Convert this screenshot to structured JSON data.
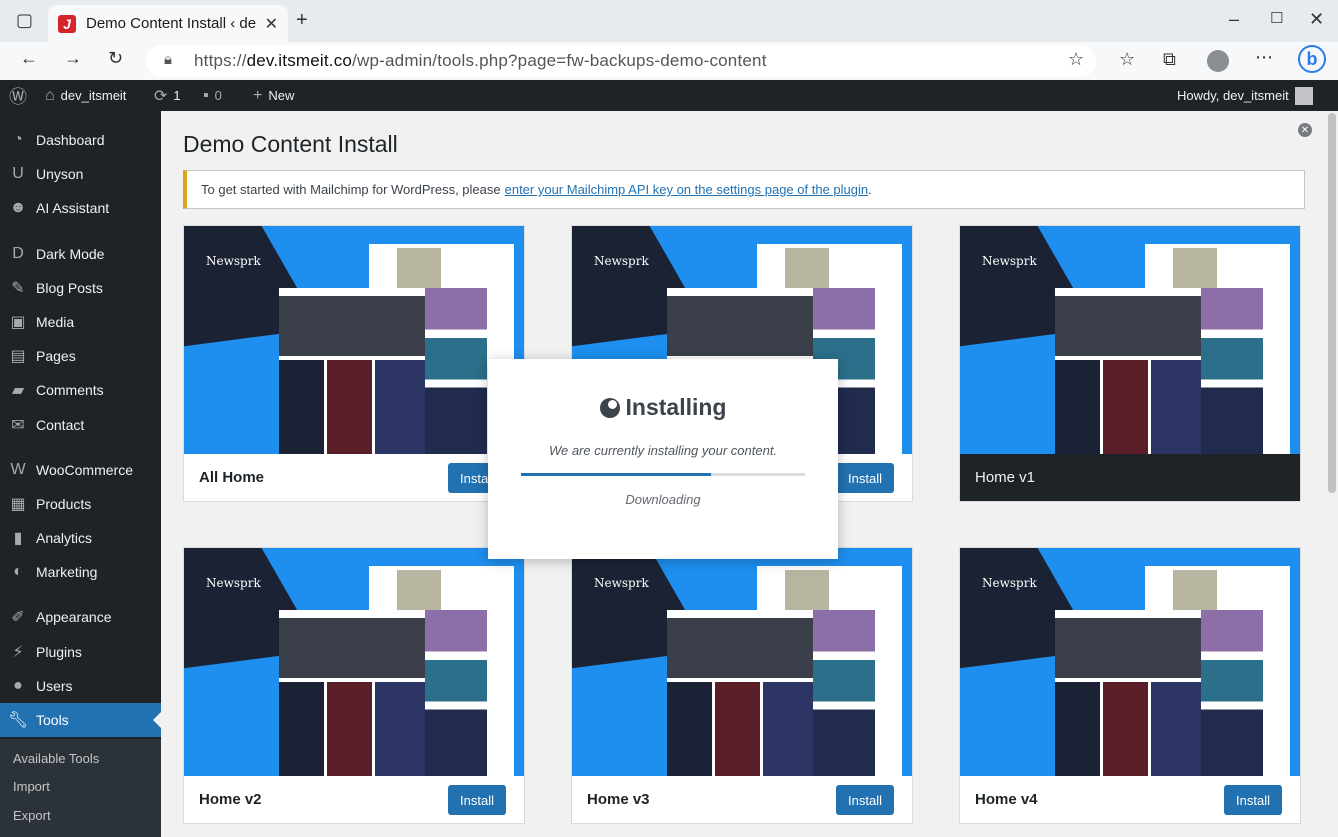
{
  "browser": {
    "tab_title": "Demo Content Install ‹ de",
    "favicon": "J",
    "url_prefix": "https://",
    "url_host": "dev.itsmeit.co",
    "url_path": "/wp-admin/tools.php?page=fw-backups-demo-content"
  },
  "adminbar": {
    "site_name": "dev_itsmeit",
    "updates_count": "1",
    "comments_count": "0",
    "new_label": "New",
    "howdy": "Howdy, dev_itsmeit"
  },
  "sidebar": {
    "items": [
      {
        "label": "Dashboard",
        "icon": "dashboard-icon"
      },
      {
        "label": "Unyson",
        "icon": "unyson-icon"
      },
      {
        "label": "AI Assistant",
        "icon": "ai-icon"
      },
      {
        "label": "Dark Mode",
        "icon": "darkmode-icon"
      },
      {
        "label": "Blog Posts",
        "icon": "pin-icon"
      },
      {
        "label": "Media",
        "icon": "media-icon"
      },
      {
        "label": "Pages",
        "icon": "pages-icon"
      },
      {
        "label": "Comments",
        "icon": "comments-icon"
      },
      {
        "label": "Contact",
        "icon": "mail-icon"
      },
      {
        "label": "WooCommerce",
        "icon": "woo-icon"
      },
      {
        "label": "Products",
        "icon": "products-icon"
      },
      {
        "label": "Analytics",
        "icon": "analytics-icon"
      },
      {
        "label": "Marketing",
        "icon": "marketing-icon"
      },
      {
        "label": "Appearance",
        "icon": "appearance-icon"
      },
      {
        "label": "Plugins",
        "icon": "plugins-icon"
      },
      {
        "label": "Users",
        "icon": "users-icon"
      },
      {
        "label": "Tools",
        "icon": "tools-icon"
      }
    ],
    "submenu": [
      "Available Tools",
      "Import",
      "Export"
    ]
  },
  "page": {
    "title": "Demo Content Install",
    "notice_text": "To get started with Mailchimp for WordPress, please",
    "notice_link": "enter your Mailchimp API key on the settings page of the plugin",
    "notice_end": "."
  },
  "cards": [
    {
      "name": "All Home",
      "button": "Install"
    },
    {
      "name": "",
      "button": "Install"
    },
    {
      "name": "Home v1",
      "button": ""
    },
    {
      "name": "Home v2",
      "button": "Install"
    },
    {
      "name": "Home v3",
      "button": "Install"
    },
    {
      "name": "Home v4",
      "button": "Install"
    }
  ],
  "thumbnail_logo": "Newsprk",
  "modal": {
    "title": "Installing",
    "message": "We are currently installing your content.",
    "status": "Downloading",
    "progress": 0.67
  },
  "colors": {
    "accent": "#2271b1",
    "adminbar": "#1d2327",
    "notice": "#dba617"
  }
}
